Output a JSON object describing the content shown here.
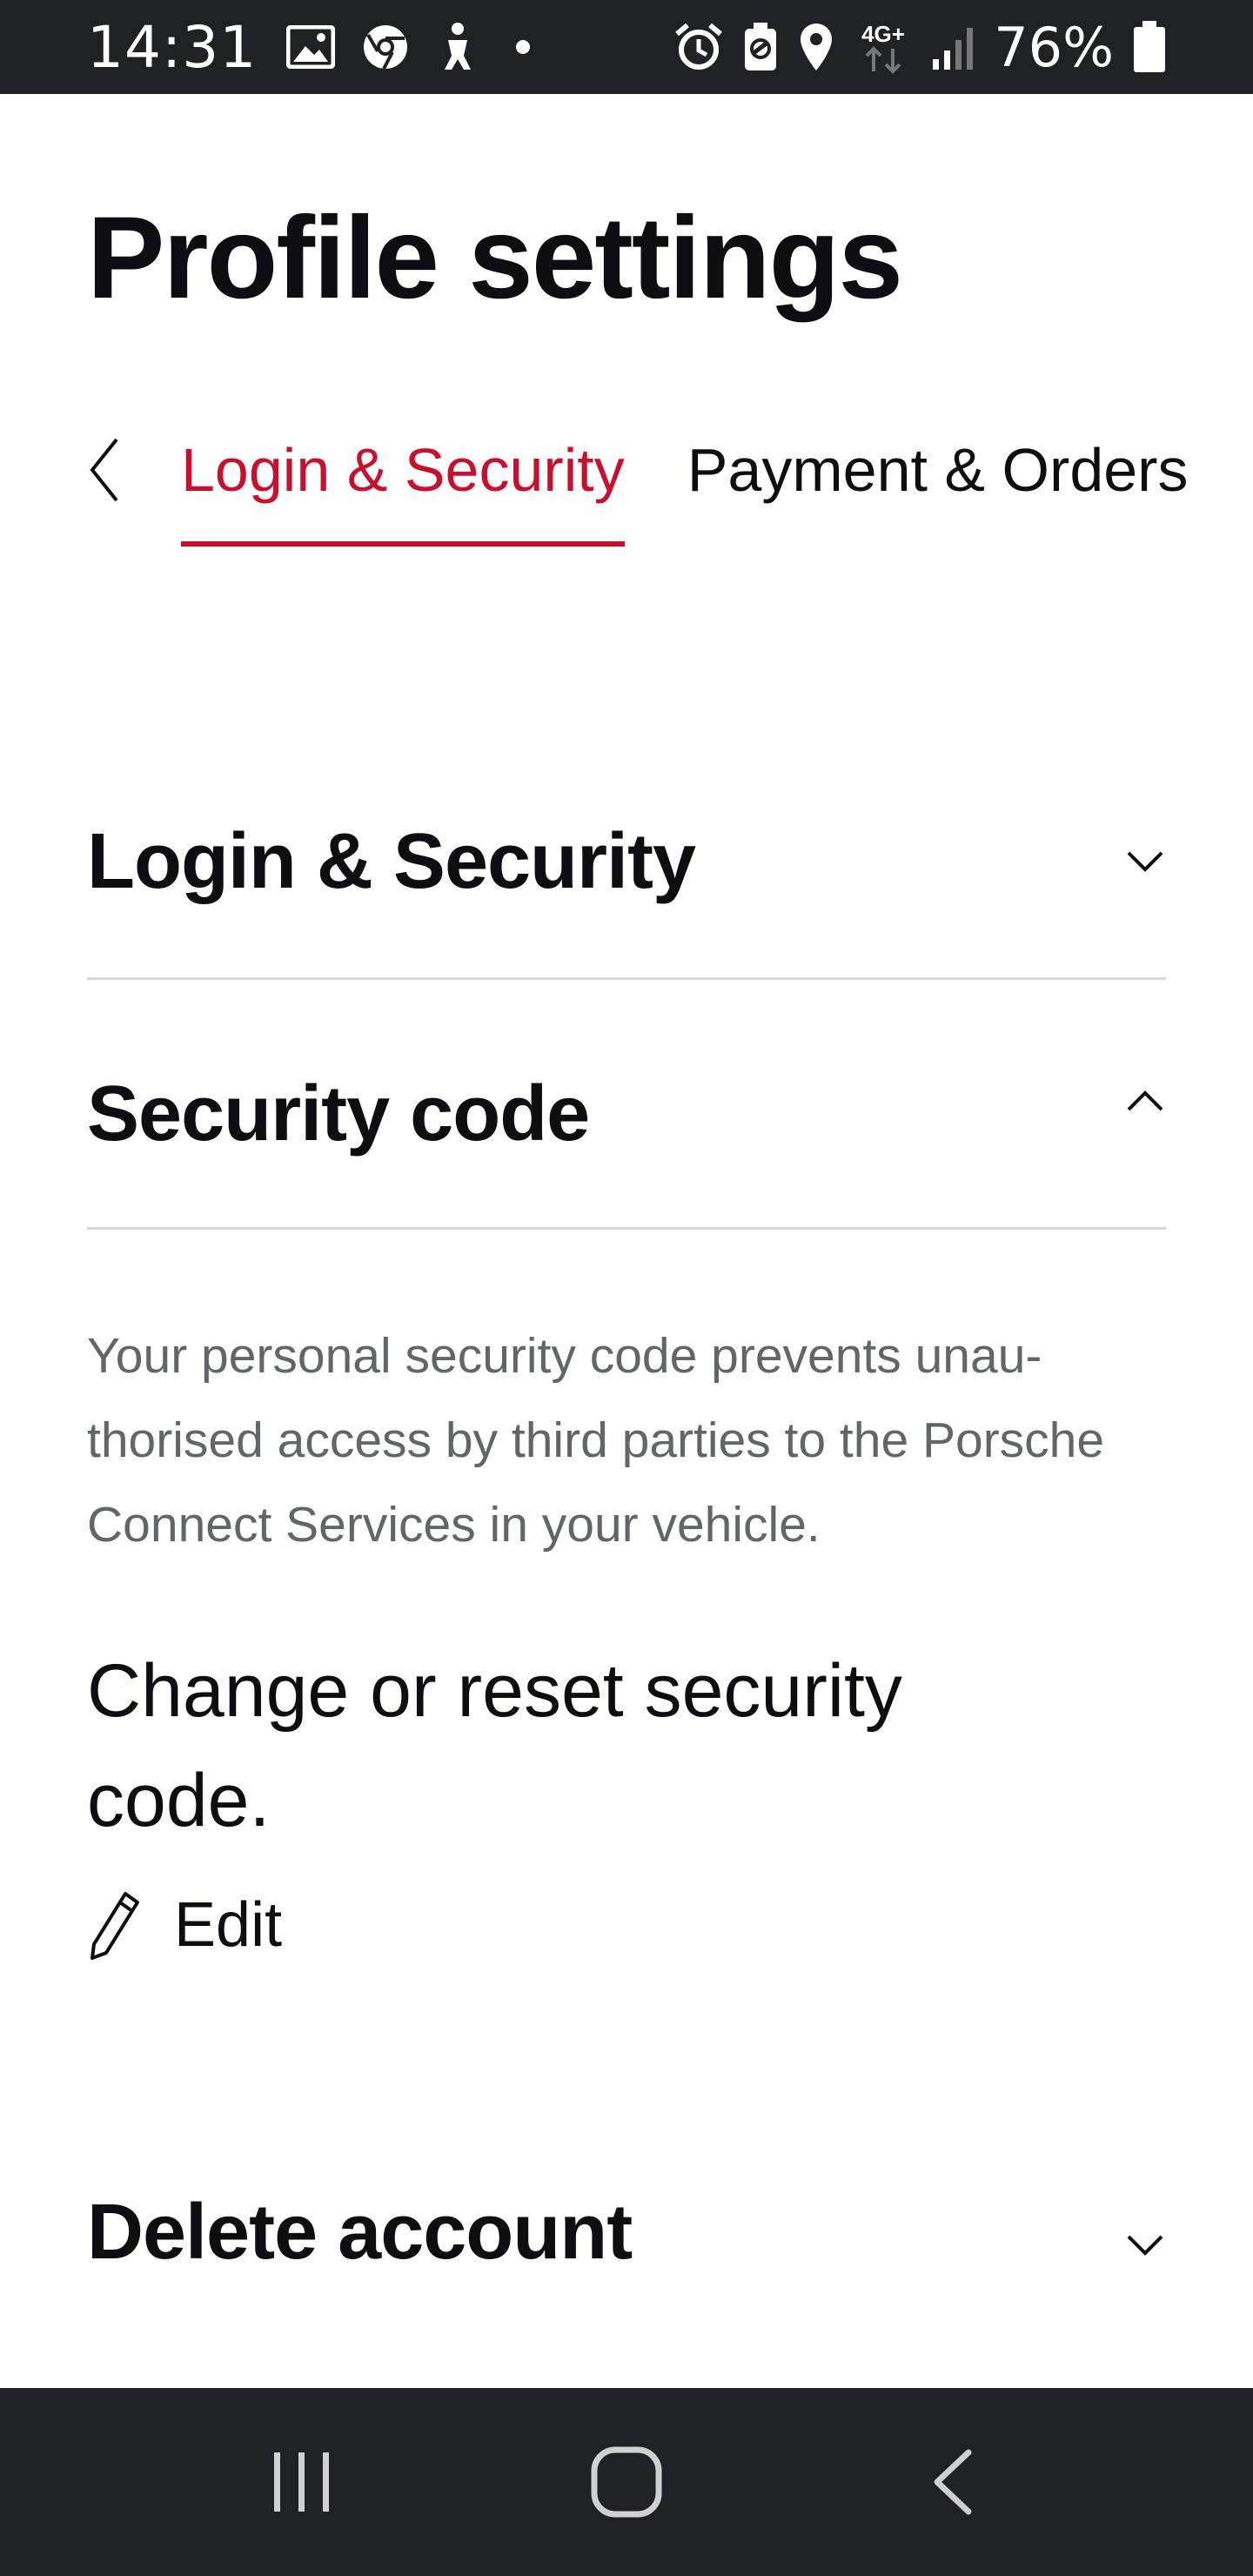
{
  "status_bar": {
    "time": "14:31",
    "battery_percent": "76%",
    "network": "4G+",
    "left_icons": [
      "gallery-icon",
      "chrome-icon",
      "accessibility-icon",
      "dot-icon"
    ],
    "right_icons": [
      "alarm-icon",
      "battery-saver-icon",
      "location-icon",
      "network-4g-icon",
      "signal-icon",
      "battery-icon"
    ]
  },
  "header": {
    "title": "Profile settings"
  },
  "tabs": {
    "items": [
      {
        "label": "Login & Security",
        "active": true
      },
      {
        "label": "Payment & Orders",
        "active": false
      }
    ]
  },
  "sections": {
    "login_security": {
      "title": "Login & Security",
      "expanded": false
    },
    "security_code": {
      "title": "Security code",
      "expanded": true,
      "description": "Your personal security code prevents unau-thorised access by third parties to the Porsche Connect Services in your vehicle.",
      "change_text": "Change or reset security code.",
      "edit_label": "Edit"
    },
    "delete_account": {
      "title": "Delete account",
      "expanded": false
    }
  },
  "colors": {
    "accent": "#c8102e",
    "text": "#0e0e12",
    "muted": "#626669",
    "bars": "#202124"
  }
}
